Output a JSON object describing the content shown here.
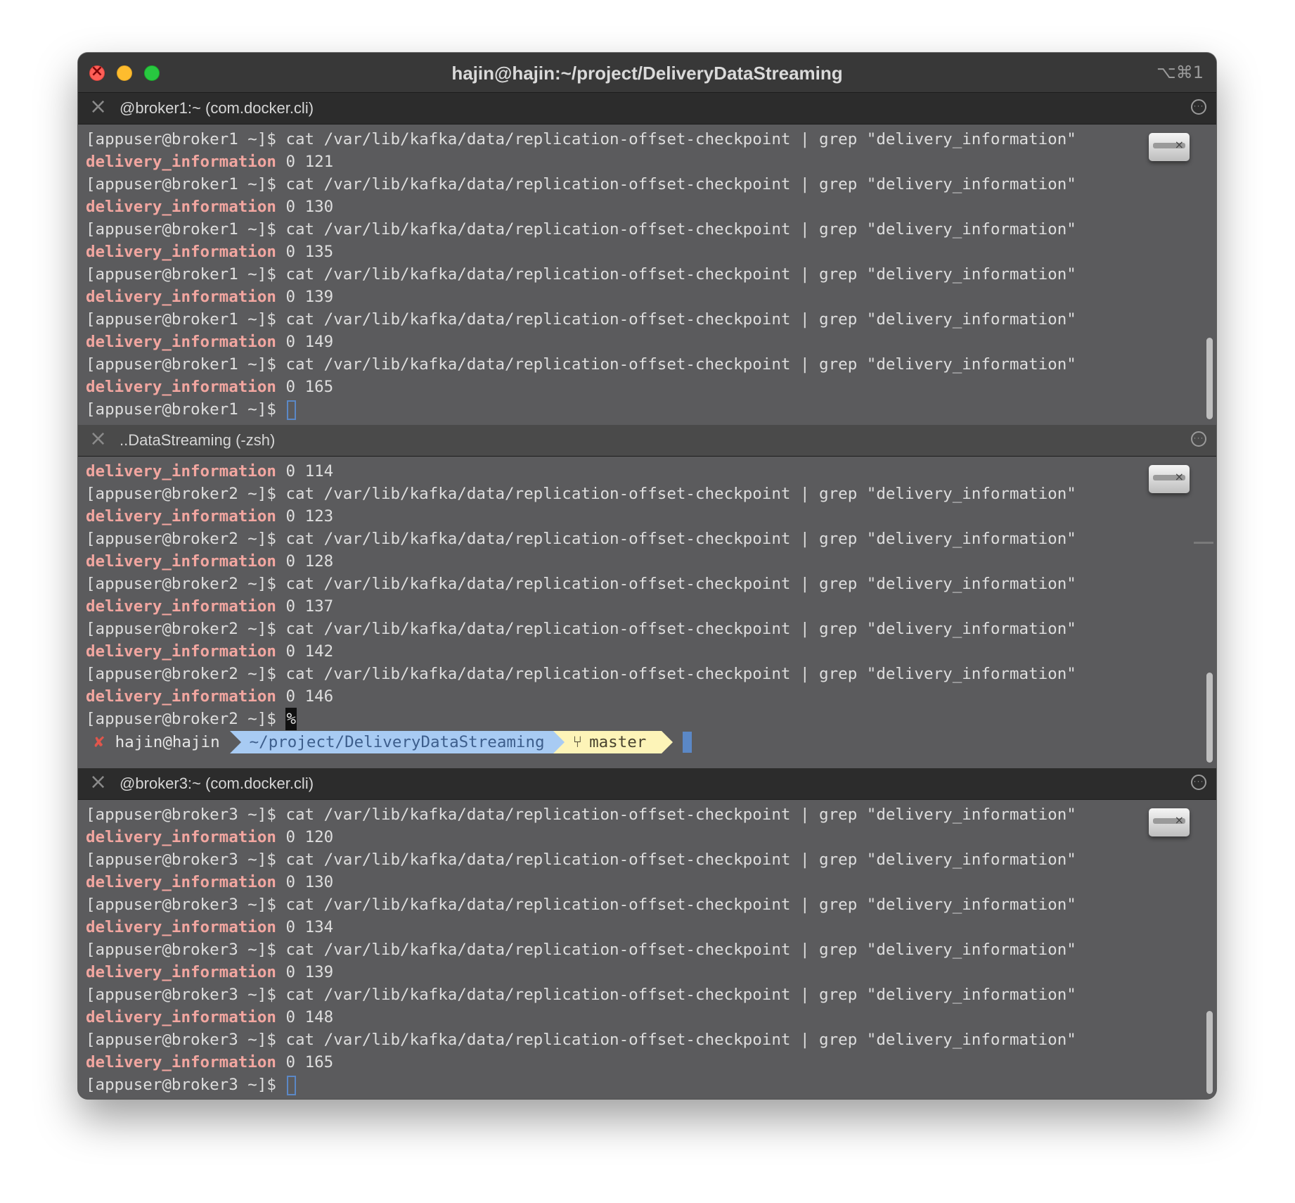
{
  "window": {
    "title": "hajin@hajin:~/project/DeliveryDataStreaming",
    "shortcut": "⌥⌘1"
  },
  "panes": [
    {
      "title": "@broker1:~ (com.docker.cli)",
      "lines": [
        "[appuser@broker1 ~]$ cat /var/lib/kafka/data/replication-offset-checkpoint | grep \"delivery_information\"",
        [
          "delivery_information",
          " 0 121"
        ],
        "[appuser@broker1 ~]$ cat /var/lib/kafka/data/replication-offset-checkpoint | grep \"delivery_information\"",
        [
          "delivery_information",
          " 0 130"
        ],
        "[appuser@broker1 ~]$ cat /var/lib/kafka/data/replication-offset-checkpoint | grep \"delivery_information\"",
        [
          "delivery_information",
          " 0 135"
        ],
        "[appuser@broker1 ~]$ cat /var/lib/kafka/data/replication-offset-checkpoint | grep \"delivery_information\"",
        [
          "delivery_information",
          " 0 139"
        ],
        "[appuser@broker1 ~]$ cat /var/lib/kafka/data/replication-offset-checkpoint | grep \"delivery_information\"",
        [
          "delivery_information",
          " 0 149"
        ],
        "[appuser@broker1 ~]$ cat /var/lib/kafka/data/replication-offset-checkpoint | grep \"delivery_information\"",
        [
          "delivery_information",
          " 0 165"
        ]
      ],
      "prompt": "[appuser@broker1 ~]$ "
    },
    {
      "title": "..DataStreaming (-zsh)",
      "lines": [
        [
          "delivery_information",
          " 0 114"
        ],
        "[appuser@broker2 ~]$ cat /var/lib/kafka/data/replication-offset-checkpoint | grep \"delivery_information\"",
        [
          "delivery_information",
          " 0 123"
        ],
        "[appuser@broker2 ~]$ cat /var/lib/kafka/data/replication-offset-checkpoint | grep \"delivery_information\"",
        [
          "delivery_information",
          " 0 128"
        ],
        "[appuser@broker2 ~]$ cat /var/lib/kafka/data/replication-offset-checkpoint | grep \"delivery_information\"",
        [
          "delivery_information",
          " 0 137"
        ],
        "[appuser@broker2 ~]$ cat /var/lib/kafka/data/replication-offset-checkpoint | grep \"delivery_information\"",
        [
          "delivery_information",
          " 0 142"
        ],
        "[appuser@broker2 ~]$ cat /var/lib/kafka/data/replication-offset-checkpoint | grep \"delivery_information\"",
        [
          "delivery_information",
          " 0 146"
        ]
      ],
      "prompt": "[appuser@broker2 ~]$ ",
      "percent": "%",
      "zsh_prompt": {
        "status": "✘",
        "user": "hajin@hajin",
        "path": "~/project/DeliveryDataStreaming",
        "branch_icon": "⑂",
        "branch": "master"
      }
    },
    {
      "title": "@broker3:~ (com.docker.cli)",
      "lines": [
        "[appuser@broker3 ~]$ cat /var/lib/kafka/data/replication-offset-checkpoint | grep \"delivery_information\"",
        [
          "delivery_information",
          " 0 120"
        ],
        "[appuser@broker3 ~]$ cat /var/lib/kafka/data/replication-offset-checkpoint | grep \"delivery_information\"",
        [
          "delivery_information",
          " 0 130"
        ],
        "[appuser@broker3 ~]$ cat /var/lib/kafka/data/replication-offset-checkpoint | grep \"delivery_information\"",
        [
          "delivery_information",
          " 0 134"
        ],
        "[appuser@broker3 ~]$ cat /var/lib/kafka/data/replication-offset-checkpoint | grep \"delivery_information\"",
        [
          "delivery_information",
          " 0 139"
        ],
        "[appuser@broker3 ~]$ cat /var/lib/kafka/data/replication-offset-checkpoint | grep \"delivery_information\"",
        [
          "delivery_information",
          " 0 148"
        ],
        "[appuser@broker3 ~]$ cat /var/lib/kafka/data/replication-offset-checkpoint | grep \"delivery_information\"",
        [
          "delivery_information",
          " 0 165"
        ]
      ],
      "prompt": "[appuser@broker3 ~]$ "
    }
  ]
}
